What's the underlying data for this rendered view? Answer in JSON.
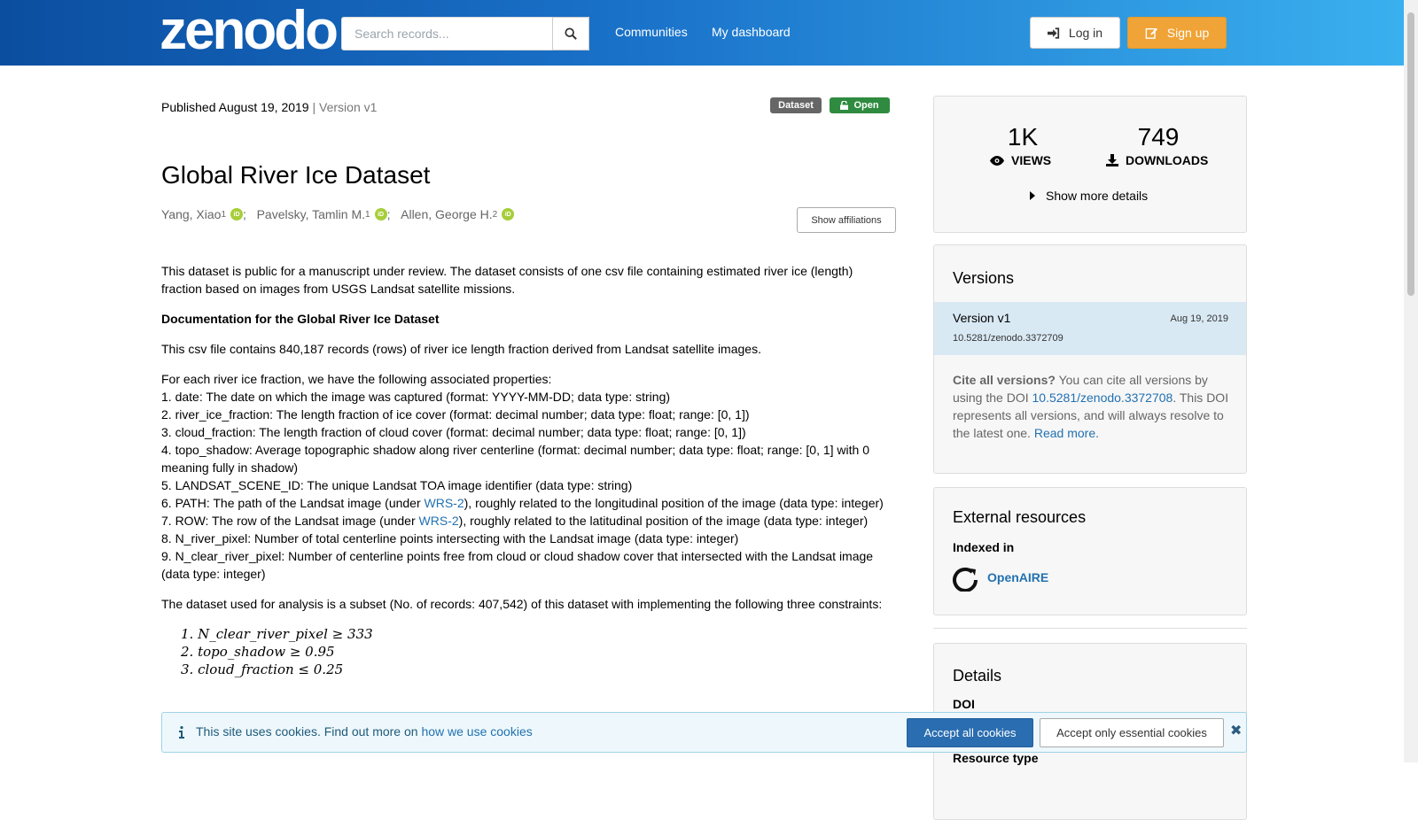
{
  "header": {
    "logo": "zenodo",
    "search_placeholder": "Search records...",
    "nav": [
      "Communities",
      "My dashboard"
    ],
    "login_label": "Log in",
    "signup_label": "Sign up"
  },
  "record": {
    "published_prefix": "Published",
    "published_date": "August 19, 2019",
    "version_sep": "|",
    "version": "Version v1",
    "badge_type": "Dataset",
    "badge_access": "Open",
    "title": "Global River Ice Dataset",
    "authors": [
      {
        "name": "Yang, Xiao",
        "aff": "1"
      },
      {
        "name": "Pavelsky, Tamlin M.",
        "aff": "1"
      },
      {
        "name": "Allen, George H.",
        "aff": "2"
      }
    ],
    "orcid_label": "iD",
    "show_affiliations": "Show affiliations"
  },
  "description": {
    "intro": "This dataset is public for a manuscript under review. The dataset consists of one csv file containing estimated river ice (length) fraction based on images from USGS Landsat satellite missions.",
    "doc_heading": "Documentation for the Global River Ice Dataset",
    "csv_info": "This csv file contains 840,187 records (rows) of river ice length fraction derived from Landsat satellite images.",
    "props_intro": "For each river ice fraction, we have the following associated properties:",
    "props": [
      "1.    date: The date on which the image was captured (format: YYYY-MM-DD; data type: string)",
      "2.    river_ice_fraction: The length fraction of ice cover (format: decimal number; data type: float; range: [0, 1])",
      "3.    cloud_fraction: The length fraction of cloud cover (format: decimal number; data type: float; range: [0, 1])",
      "4.    topo_shadow: Average topographic shadow along river centerline (format: decimal number; data type: float; range: [0, 1] with 0 meaning fully in shadow)",
      "5.    LANDSAT_SCENE_ID: The unique Landsat TOA image identifier (data type: string)"
    ],
    "prop6_pre": "6.    PATH: The path of the Landsat image (under ",
    "prop6_link": "WRS-2",
    "prop6_post": "), roughly related to the longitudinal position of the image (data type: integer)",
    "prop7_pre": "7.    ROW: The row of the Landsat image (under ",
    "prop7_link": "WRS-2",
    "prop7_post": "), roughly related to the latitudinal position of the image (data type: integer)",
    "prop8": "8.    N_river_pixel: Number of total centerline points intersecting with the Landsat image (data type: integer)",
    "prop9": "9.    N_clear_river_pixel: Number of centerline points free from cloud or cloud shadow cover that intersected with the Landsat image (data type: integer)",
    "subset": "The dataset used for analysis is a subset (No. of records: 407,542) of this dataset with implementing the following three constraints:",
    "constraints": [
      "1.  N_clear_river_pixel ≥ 333",
      "2. topo_shadow ≥ 0.95",
      "3. cloud_fraction ≤ 0.25"
    ]
  },
  "stats": {
    "views": "1K",
    "views_label": "VIEWS",
    "downloads": "749",
    "downloads_label": "DOWNLOADS",
    "more": "Show more details"
  },
  "versions": {
    "heading": "Versions",
    "current_label": "Version v1",
    "current_date": "Aug 19, 2019",
    "current_doi": "10.5281/zenodo.3372709",
    "cite_bold": "Cite all versions?",
    "cite_text": " You can cite all versions by using the DOI ",
    "cite_doi": "10.5281/zenodo.3372708",
    "cite_text2": ". This DOI represents all versions, and will always resolve to the latest one. ",
    "read_more": "Read more."
  },
  "external": {
    "heading": "External resources",
    "indexed_in": "Indexed in",
    "openaire": "OpenAIRE"
  },
  "details": {
    "heading": "Details",
    "doi_label": "DOI",
    "resource_type": "Resource type"
  },
  "cookie": {
    "text": "This site uses cookies. Find out more on ",
    "link": "how we use cookies",
    "accept_all": "Accept all cookies",
    "accept_essential": "Accept only essential cookies"
  },
  "colors": {
    "header_start": "#0b4ea0",
    "header_end": "#3ab0ef",
    "signup": "#f0a336",
    "badge_type": "#666666",
    "badge_open": "#2e8b3f",
    "link": "#2271b1"
  }
}
